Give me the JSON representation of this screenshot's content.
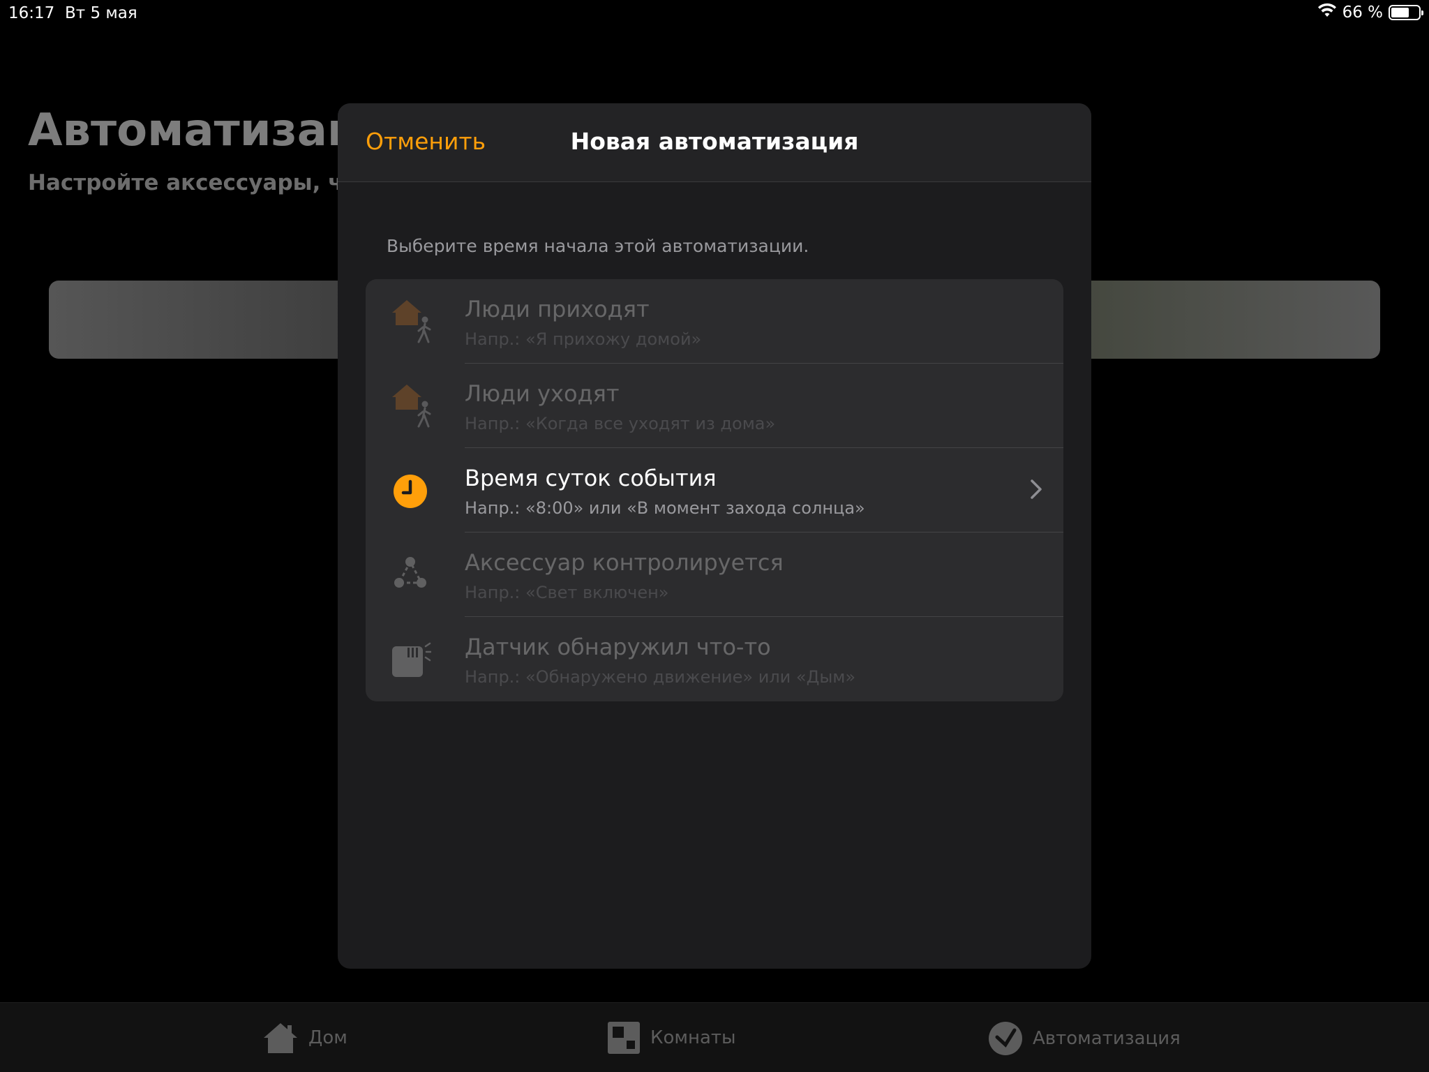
{
  "status_bar": {
    "time": "16:17",
    "date": "Вт 5 мая",
    "battery": "66 %",
    "battery_level": 0.66
  },
  "background": {
    "title": "Автоматизация",
    "subtitle": "Настройте аксессуары, чтобы"
  },
  "modal": {
    "cancel_label": "Отменить",
    "title": "Новая автоматизация",
    "prompt": "Выберите время начала этой автоматизации.",
    "options": [
      {
        "title": "Люди приходят",
        "subtitle": "Напр.: «Я прихожу домой»",
        "icon": "home-person-icon",
        "enabled": false
      },
      {
        "title": "Люди уходят",
        "subtitle": "Напр.: «Когда все уходят из дома»",
        "icon": "home-person-icon",
        "enabled": false
      },
      {
        "title": "Время суток события",
        "subtitle": "Напр.: «8:00» или «В момент захода солнца»",
        "icon": "clock-icon",
        "enabled": true
      },
      {
        "title": "Аксессуар контролируется",
        "subtitle": "Напр.: «Свет включен»",
        "icon": "accessory-icon",
        "enabled": false
      },
      {
        "title": "Датчик обнаружил что-то",
        "subtitle": "Напр.: «Обнаружено движение» или «Дым»",
        "icon": "sensor-icon",
        "enabled": false
      }
    ]
  },
  "tab_bar": {
    "tabs": [
      {
        "label": "Дом",
        "icon": "home-icon"
      },
      {
        "label": "Комнаты",
        "icon": "rooms-icon"
      },
      {
        "label": "Автоматизация",
        "icon": "automation-icon"
      }
    ]
  },
  "colors": {
    "accent": "#ff9f0a",
    "modal_bg": "#1c1c1e",
    "list_bg": "#2c2c2e"
  }
}
